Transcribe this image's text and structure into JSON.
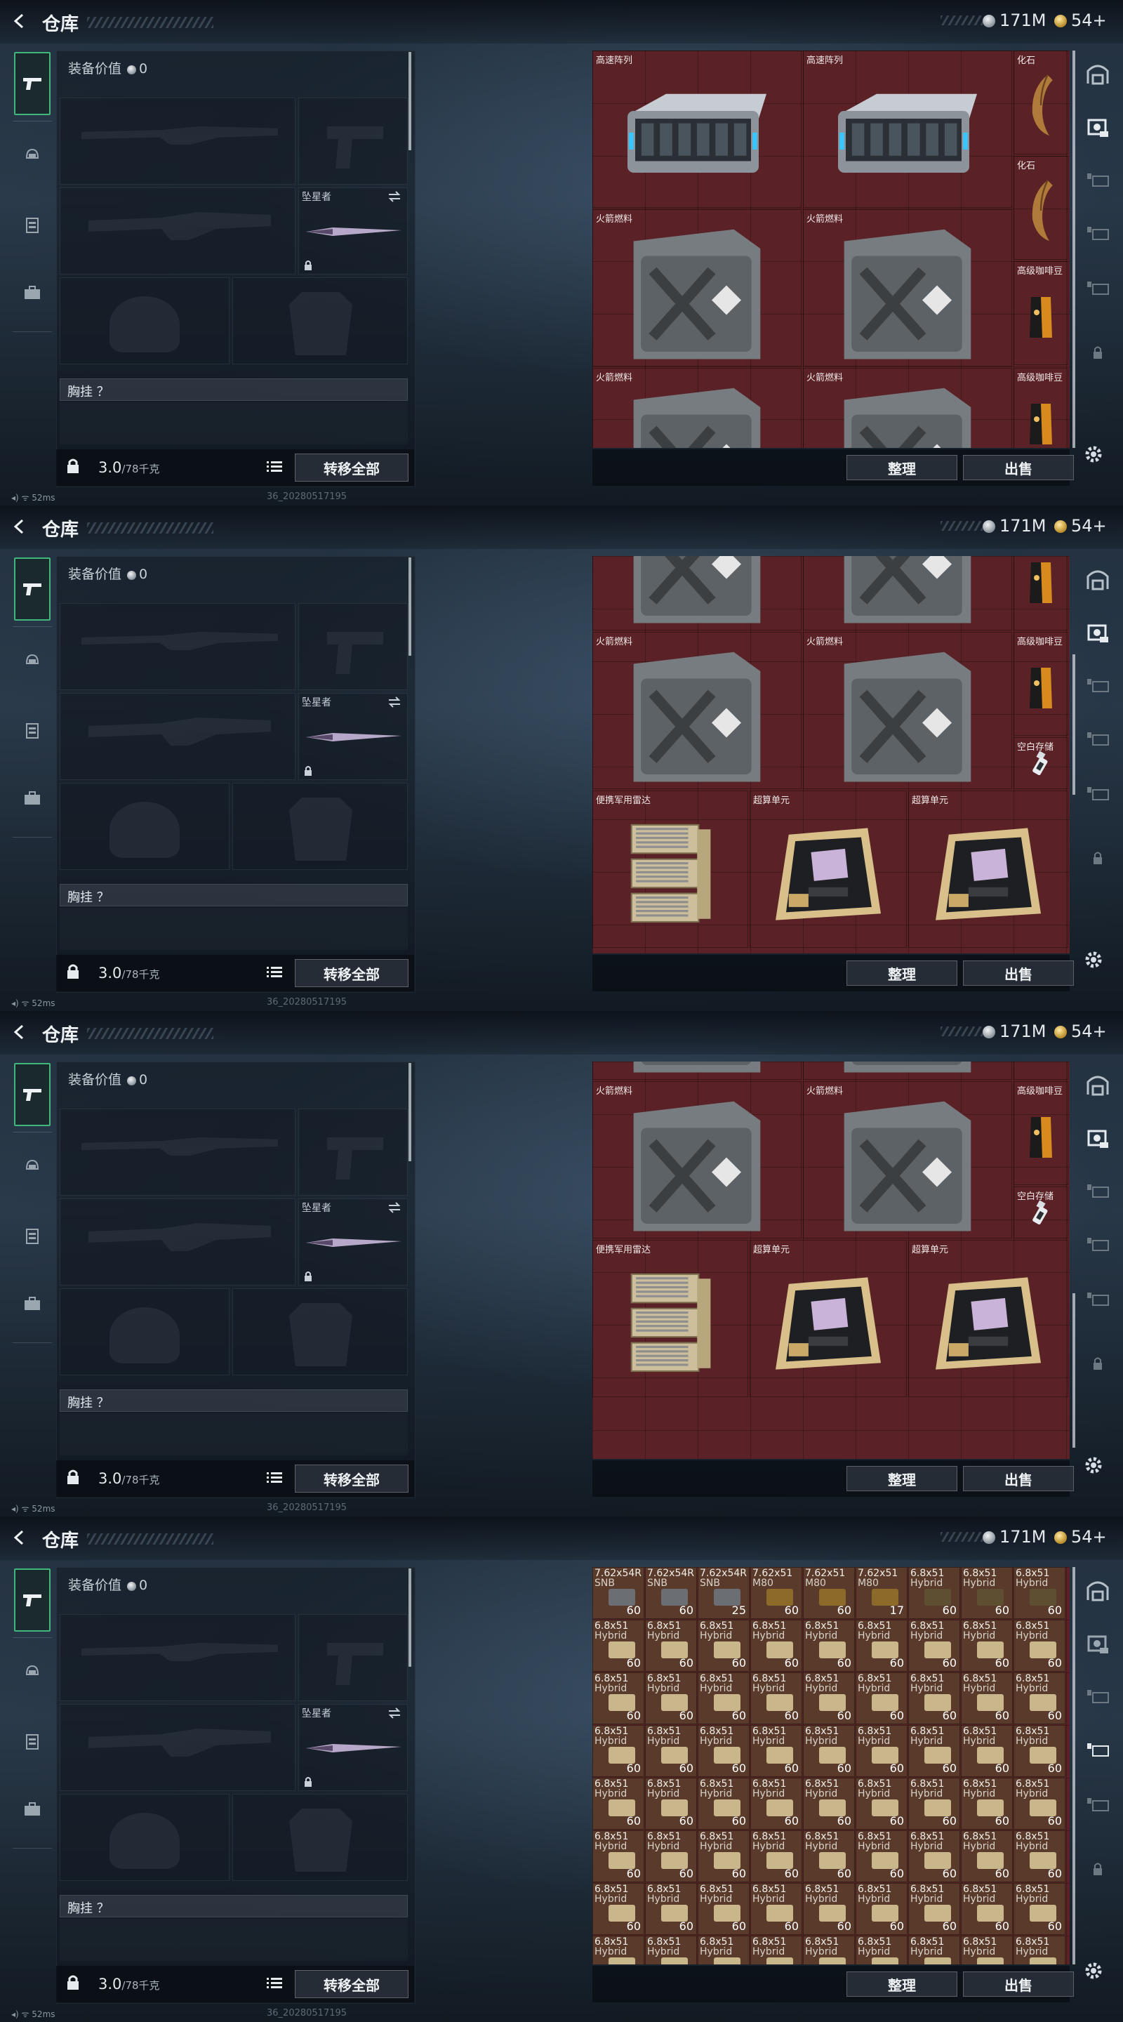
{
  "header": {
    "title": "仓库",
    "silver": "171M",
    "gold": "54+"
  },
  "equipment": {
    "value_label": "装备价值",
    "value": "0",
    "melee_label": "坠星者",
    "chest_label": "胸挂 ？"
  },
  "bottom": {
    "weight": "3.0",
    "weight_cap": "/78千克",
    "transfer_all": "转移全部"
  },
  "actions": {
    "sort": "整理",
    "sell": "出售"
  },
  "status": {
    "ping": "52ms",
    "version": "36_20280517195"
  },
  "items": {
    "server": "高速阵列",
    "fossil": "化石",
    "fuel": "火箭燃料",
    "coffee": "高级咖啡豆",
    "drive": "空白存储",
    "radar": "便携军用雷达",
    "compute": "超算单元"
  },
  "ammo": {
    "row0": [
      {
        "n": "7.62x54R",
        "sub": "SNB",
        "c": "60",
        "col": "#6b6e72"
      },
      {
        "n": "7.62x54R",
        "sub": "SNB",
        "c": "60",
        "col": "#6b6e72"
      },
      {
        "n": "7.62x54R",
        "sub": "SNB",
        "c": "25",
        "col": "#6b6e72"
      },
      {
        "n": "7.62x51",
        "sub": "M80",
        "c": "60",
        "col": "#8c6b2a"
      },
      {
        "n": "7.62x51",
        "sub": "M80",
        "c": "60",
        "col": "#8c6b2a"
      },
      {
        "n": "7.62x51",
        "sub": "M80",
        "c": "17",
        "col": "#8c6b2a"
      },
      {
        "n": "6.8x51",
        "sub": "Hybrid",
        "c": "60",
        "col": "#5e4e32"
      },
      {
        "n": "6.8x51",
        "sub": "Hybrid",
        "c": "60",
        "col": "#5e4e32"
      },
      {
        "n": "6.8x51",
        "sub": "Hybrid",
        "c": "60",
        "col": "#5e4e32"
      }
    ],
    "hybrid": {
      "n": "6.8x51",
      "sub": "Hybrid",
      "c": "60"
    }
  }
}
